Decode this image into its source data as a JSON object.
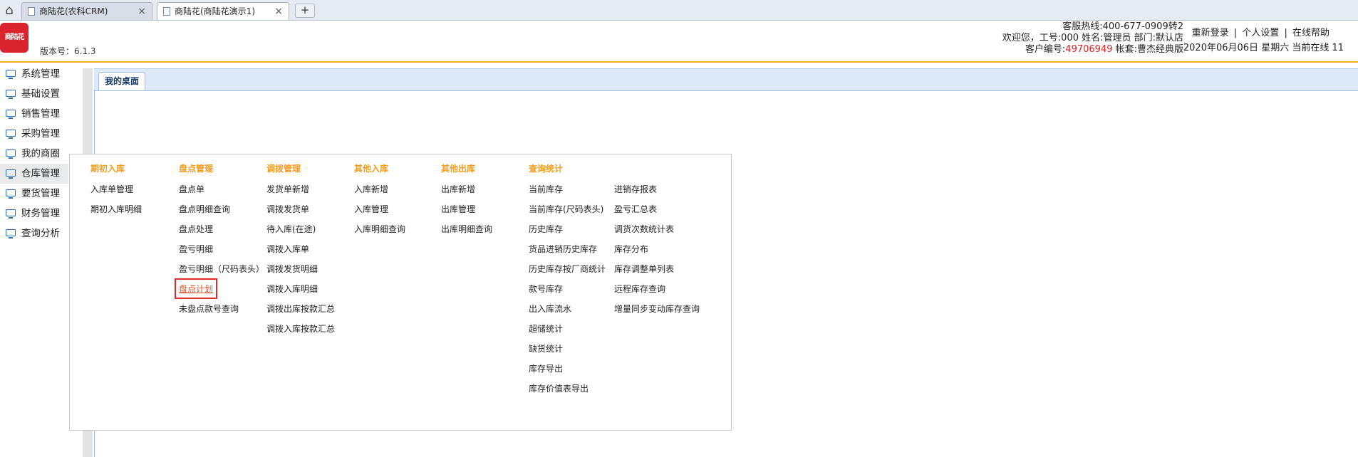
{
  "browser": {
    "tabs": [
      {
        "title": "商陆花(农科CRM)"
      },
      {
        "title": "商陆花(商陆花演示1)"
      }
    ],
    "close_glyph": "×",
    "new_tab_glyph": "+",
    "home_glyph": "⌂"
  },
  "header": {
    "logo_text": "商陆花",
    "version": "版本号：6.1.3",
    "hotline": "客服热线:400-677-0909转2",
    "welcome": "欢迎您，工号:000 姓名:管理员 部门:默认店",
    "customer_prefix": "客户编号:",
    "customer_no": "49706949",
    "account": "帐套:曹杰经典版",
    "links": {
      "relogin": "重新登录",
      "settings": "个人设置",
      "help": "在线帮助",
      "sep": "|"
    },
    "datetime": "2020年06月06日 星期六 当前在线 11",
    "accent_color": "#f5a623",
    "logo_color": "#d9232d"
  },
  "sidebar": {
    "items": [
      {
        "label": "系统管理"
      },
      {
        "label": "基础设置"
      },
      {
        "label": "销售管理"
      },
      {
        "label": "采购管理"
      },
      {
        "label": "我的商圈"
      },
      {
        "label": "仓库管理"
      },
      {
        "label": "要货管理"
      },
      {
        "label": "财务管理"
      },
      {
        "label": "查询分析"
      }
    ],
    "active": "仓库管理"
  },
  "content": {
    "tab": "我的桌面"
  },
  "flyout": {
    "columns": [
      {
        "title": "期初入库",
        "items": [
          "入库单管理",
          "期初入库明细"
        ]
      },
      {
        "title": "盘点管理",
        "items": [
          "盘点单",
          "盘点明细查询",
          "盘点处理",
          "盈亏明细",
          "盈亏明细（尺码表头）",
          "盘点计划",
          "未盘点款号查询"
        ]
      },
      {
        "title": "调拨管理",
        "items": [
          "发货单新增",
          "调拨发货单",
          "待入库(在途)",
          "调拨入库单",
          "调拨发货明细",
          "调拨入库明细",
          "调拨出库按款汇总",
          "调拨入库按款汇总"
        ]
      },
      {
        "title": "其他入库",
        "items": [
          "入库新增",
          "入库管理",
          "入库明细查询"
        ]
      },
      {
        "title": "其他出库",
        "items": [
          "出库新增",
          "出库管理",
          "出库明细查询"
        ]
      },
      {
        "title": "查询统计",
        "items": [
          "当前库存",
          "当前库存(尺码表头)",
          "历史库存",
          "货品进销历史库存",
          "历史库存按厂商统计",
          "款号库存",
          "出入库流水",
          "超储统计",
          "缺货统计",
          "库存导出",
          "库存价值表导出"
        ]
      },
      {
        "title": "",
        "items": [
          "进销存报表",
          "盈亏汇总表",
          "调货次数统计表",
          "库存分布",
          "库存调整单列表",
          "远程库存查询",
          "增量同步变动库存查询"
        ]
      }
    ],
    "highlighted_item": "盘点计划",
    "header_color": "#f39c1d",
    "highlight_color": "#e32b2b"
  }
}
